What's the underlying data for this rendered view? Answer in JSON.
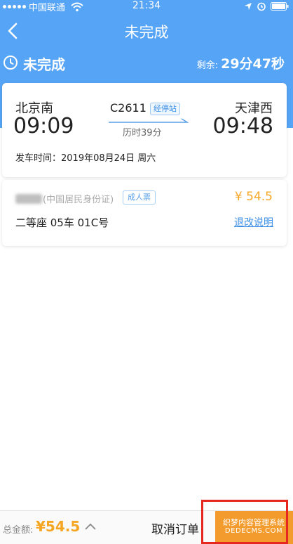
{
  "status_bar": {
    "carrier": "中国联通",
    "time": "21:34"
  },
  "nav": {
    "title": "未完成"
  },
  "order_status": {
    "label": "未完成",
    "remaining_label": "剩余:",
    "remaining_value": "29分47秒"
  },
  "train": {
    "from_station": "北京南",
    "from_time": "09:09",
    "to_station": "天津西",
    "to_time": "09:48",
    "number": "C2611",
    "via_label": "经停站",
    "duration": "历时39分",
    "depart_line": "发车时间：2019年08月24日 周六"
  },
  "passenger": {
    "id_type": "(中国居民身份证)",
    "ticket_type": "成人票",
    "price": "¥ 54.5",
    "seat": "二等座 05车 01C号",
    "refund_link": "退改说明"
  },
  "bottom_bar": {
    "total_label": "总金额:",
    "total_value": "¥54.5",
    "cancel_label": "取消订单"
  },
  "watermark": {
    "line1": "织梦内容管理系统",
    "line2": "DEDECMS.COM"
  },
  "colors": {
    "header_blue": "#56a4f5",
    "accent_orange": "#f39c2d",
    "price_orange": "#f5a623",
    "link_blue": "#3a8ee6",
    "highlight_red": "#e5271f"
  }
}
